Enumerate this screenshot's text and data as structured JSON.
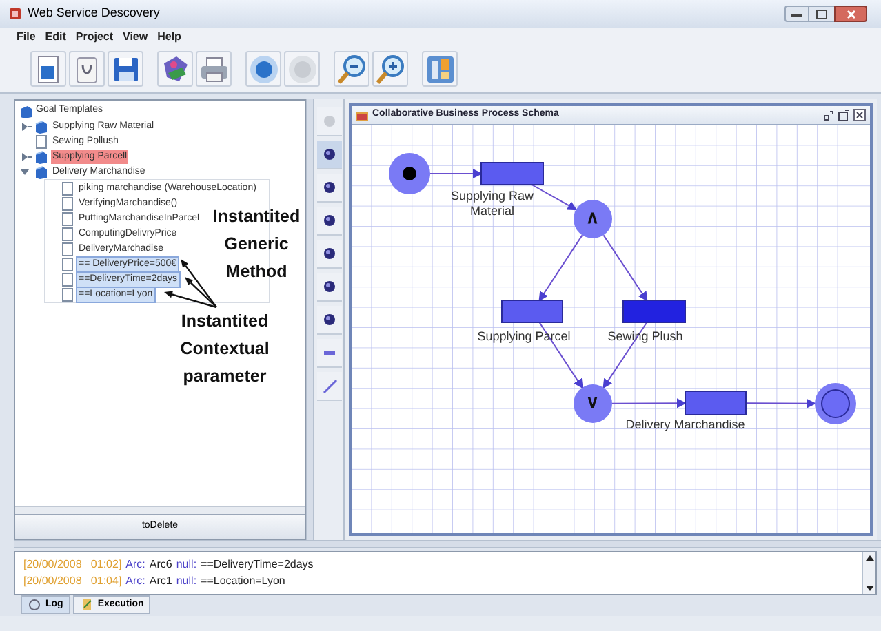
{
  "window": {
    "title": "Web Service Descovery"
  },
  "menu": [
    "File",
    "Edit",
    "Project",
    "View",
    "Help"
  ],
  "goal_tree": {
    "label": "Goal Templates",
    "children": [
      {
        "label": "Supplying Raw Material",
        "kind": "folder",
        "expanded": false,
        "flagged": false,
        "selected": false
      },
      {
        "label": "Sewing Pollush",
        "kind": "leaf",
        "flagged": false,
        "selected": false
      },
      {
        "label": "Supplying Parcell",
        "kind": "folder",
        "expanded": false,
        "flagged": true,
        "selected": false
      },
      {
        "label": "Delivery Marchandise",
        "kind": "folder",
        "expanded": true,
        "flagged": false,
        "selected": false,
        "children": [
          {
            "label": "piking marchandise (WarehouseLocation)",
            "kind": "leaf",
            "flagged": false,
            "selected": false
          },
          {
            "label": "VerifyingMarchandise()",
            "kind": "leaf",
            "flagged": false,
            "selected": false
          },
          {
            "label": "PuttingMarchandiseInParcel",
            "kind": "leaf",
            "flagged": false,
            "selected": false
          },
          {
            "label": "ComputingDelivryPrice",
            "kind": "leaf",
            "flagged": false,
            "selected": false
          },
          {
            "label": "DeliveryMarchadise",
            "kind": "leaf",
            "flagged": false,
            "selected": false
          },
          {
            "label": "== DeliveryPrice=500€",
            "kind": "leaf",
            "flagged": false,
            "selected": true
          },
          {
            "label": "==DeliveryTime=2days",
            "kind": "leaf",
            "flagged": false,
            "selected": true
          },
          {
            "label": "==Location=Lyon",
            "kind": "leaf",
            "flagged": false,
            "selected": true
          }
        ]
      }
    ]
  },
  "annotations": [
    {
      "text": "Instantited Generic Method"
    },
    {
      "text": "Instantited Contextual parameter"
    }
  ],
  "delete_button": "toDelete",
  "schema_window": {
    "title": "Collaborative Business Process Schema",
    "nodes": [
      {
        "kind": "start",
        "selected": false
      },
      {
        "kind": "task",
        "label": "Supplying Raw Material",
        "selected": false
      },
      {
        "kind": "and",
        "label": "∧",
        "selected": false
      },
      {
        "kind": "task",
        "label": "Supplying Parcel",
        "selected": false
      },
      {
        "kind": "task",
        "label": "Sewing Plush",
        "selected": true
      },
      {
        "kind": "or",
        "label": "∨",
        "selected": false
      },
      {
        "kind": "task",
        "label": "Delivery Marchandise",
        "selected": false
      },
      {
        "kind": "end",
        "selected": false
      }
    ]
  },
  "log": [
    {
      "timestamp": "[20/00/2008   01:02]",
      "arc_label": "Arc:",
      "arc": "Arc6",
      "null_label": "null:",
      "value": "==DeliveryTime=2days"
    },
    {
      "timestamp": "[20/00/2008   01:04]",
      "arc_label": "Arc:",
      "arc": "Arc1",
      "null_label": "null:",
      "value": "==Location=Lyon"
    }
  ],
  "bottom_tabs": [
    {
      "label": "Log",
      "selected": true
    },
    {
      "label": "Execution",
      "selected": false
    }
  ]
}
